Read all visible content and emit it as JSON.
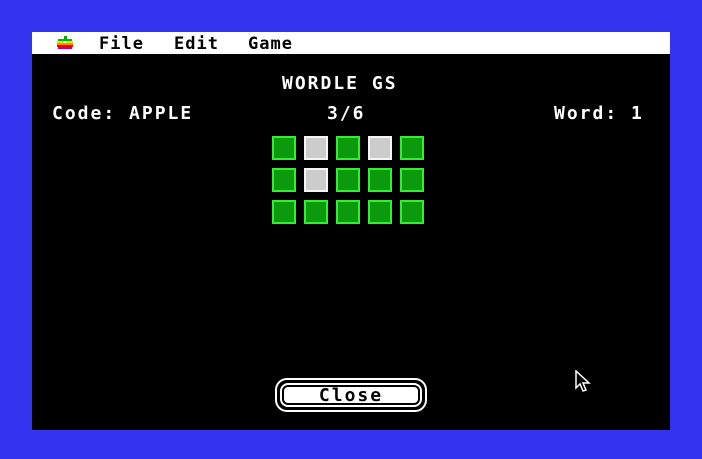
{
  "menubar": {
    "items": [
      "File",
      "Edit",
      "Game"
    ]
  },
  "game": {
    "title": "WORDLE GS",
    "code_label": "Code: APPLE",
    "progress": "3/6",
    "word_label": "Word: 1",
    "grid": [
      [
        "green",
        "gray",
        "green",
        "gray",
        "green"
      ],
      [
        "green",
        "gray",
        "green",
        "green",
        "green"
      ],
      [
        "green",
        "green",
        "green",
        "green",
        "green"
      ]
    ]
  },
  "close_button": {
    "label": "Close"
  },
  "colors": {
    "desktop": "#3333f0",
    "tile_green": "#0b9a0b",
    "tile_green_border": "#33ee33",
    "tile_gray": "#cccccc"
  },
  "icons": {
    "apple": "apple-logo-icon",
    "pointer": "arrow-pointer-icon"
  }
}
